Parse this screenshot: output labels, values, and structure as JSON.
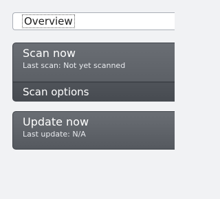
{
  "overview": {
    "label": "Overview"
  },
  "scan": {
    "title": "Scan now",
    "subtitle": "Last scan: Not yet scanned",
    "options_label": "Scan options"
  },
  "update": {
    "title": "Update now",
    "subtitle": "Last update: N/A"
  }
}
